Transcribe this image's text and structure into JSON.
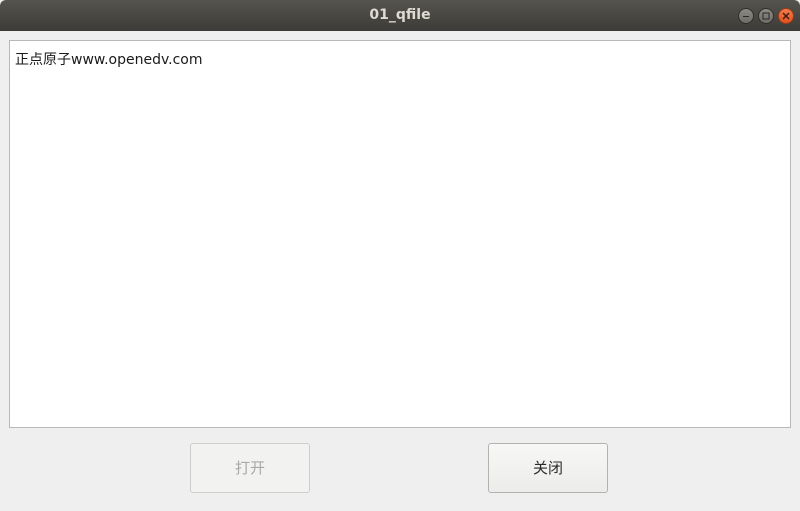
{
  "window": {
    "title": "01_qfile",
    "controls": {
      "minimize_icon": "minimize-icon",
      "maximize_icon": "maximize-icon",
      "close_icon": "close-icon"
    }
  },
  "editor": {
    "content": "正点原子www.openedv.com"
  },
  "buttons": {
    "open_label": "打开",
    "open_enabled": false,
    "close_label": "关闭",
    "close_enabled": true
  },
  "colors": {
    "titlebar": "#3c3b37",
    "close_button": "#e95420",
    "window_bg": "#efefef",
    "editor_bg": "#ffffff"
  }
}
